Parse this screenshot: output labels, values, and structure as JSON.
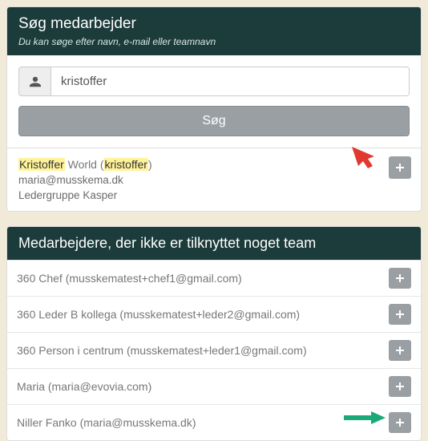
{
  "search_panel": {
    "title": "Søg medarbejder",
    "subtitle": "Du kan søge efter navn, e-mail eller teamnavn",
    "input_value": "kristoffer",
    "submit_label": "Søg"
  },
  "search_result": {
    "name_highlight": "Kristoffer",
    "name_rest": " World (",
    "login_highlight": "kristoffer",
    "login_rest": ")",
    "email": "maria@musskema.dk",
    "team": "Ledergruppe Kasper"
  },
  "unassigned_panel": {
    "title": "Medarbejdere, der ikke er tilknyttet noget team",
    "rows": [
      {
        "label": "360 Chef (musskematest+chef1@gmail.com)"
      },
      {
        "label": "360 Leder B kollega (musskematest+leder2@gmail.com)"
      },
      {
        "label": "360 Person i centrum (musskematest+leder1@gmail.com)"
      },
      {
        "label": "Maria (maria@evovia.com)"
      },
      {
        "label": "Niller Fanko (maria@musskema.dk)"
      }
    ]
  }
}
